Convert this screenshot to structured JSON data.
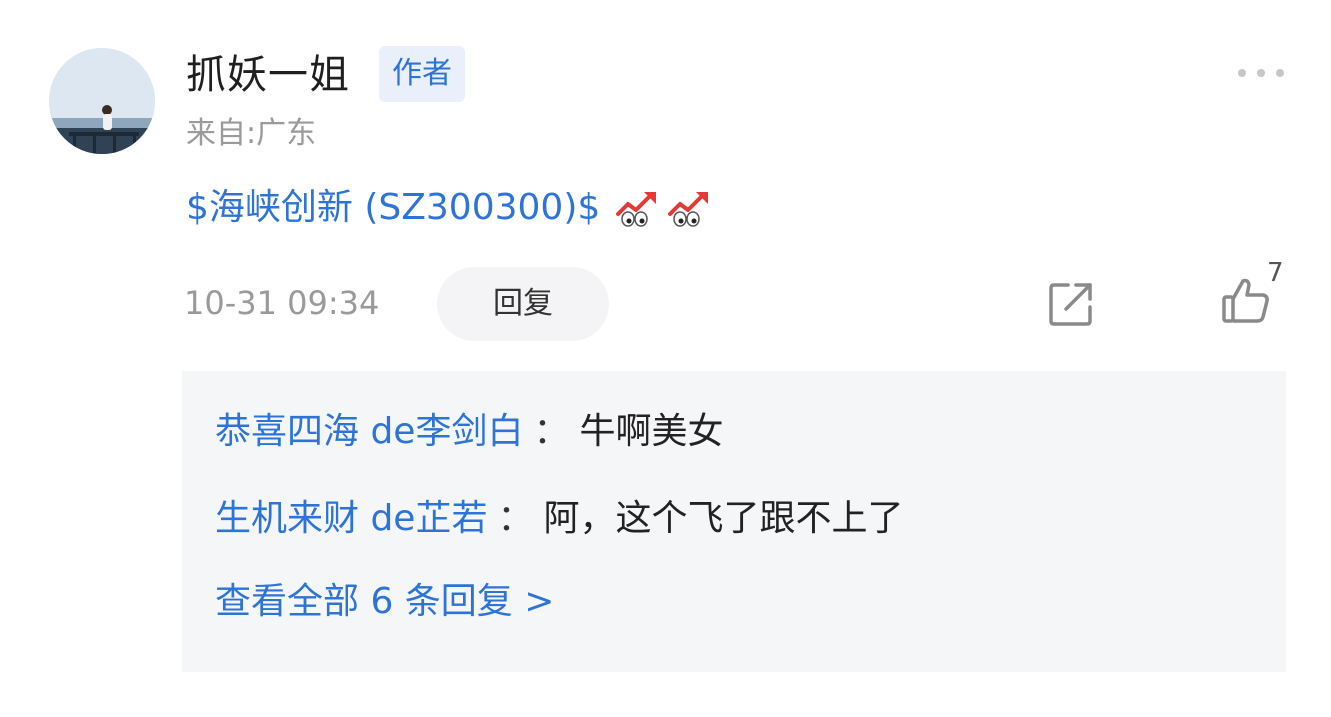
{
  "post": {
    "username": "抓妖一姐",
    "badge": "作者",
    "location": "来自:广东",
    "content_link": "$海峡创新 (SZ300300)$",
    "emojis": [
      "rising-chart-eyes-emoji",
      "rising-chart-eyes-emoji"
    ],
    "timestamp": "10-31 09:34",
    "reply_label": "回复",
    "like_count": "7"
  },
  "replies": {
    "items": [
      {
        "author": "恭喜四海 de李剑白",
        "separator": "：",
        "text": "牛啊美女"
      },
      {
        "author": "生机来财 de芷若",
        "separator": "：",
        "text": "阿，这个飞了跟不上了"
      }
    ],
    "view_all": "查看全部 6 条回复 >"
  },
  "icons": {
    "more": "more-dots-icon",
    "share": "share-icon",
    "like": "thumbs-up-icon"
  },
  "colors": {
    "link_blue": "#2d74d6",
    "badge_bg": "#e9f0fb",
    "muted_gray": "#9a9a9a",
    "reply_box_bg": "#f5f6f8"
  }
}
